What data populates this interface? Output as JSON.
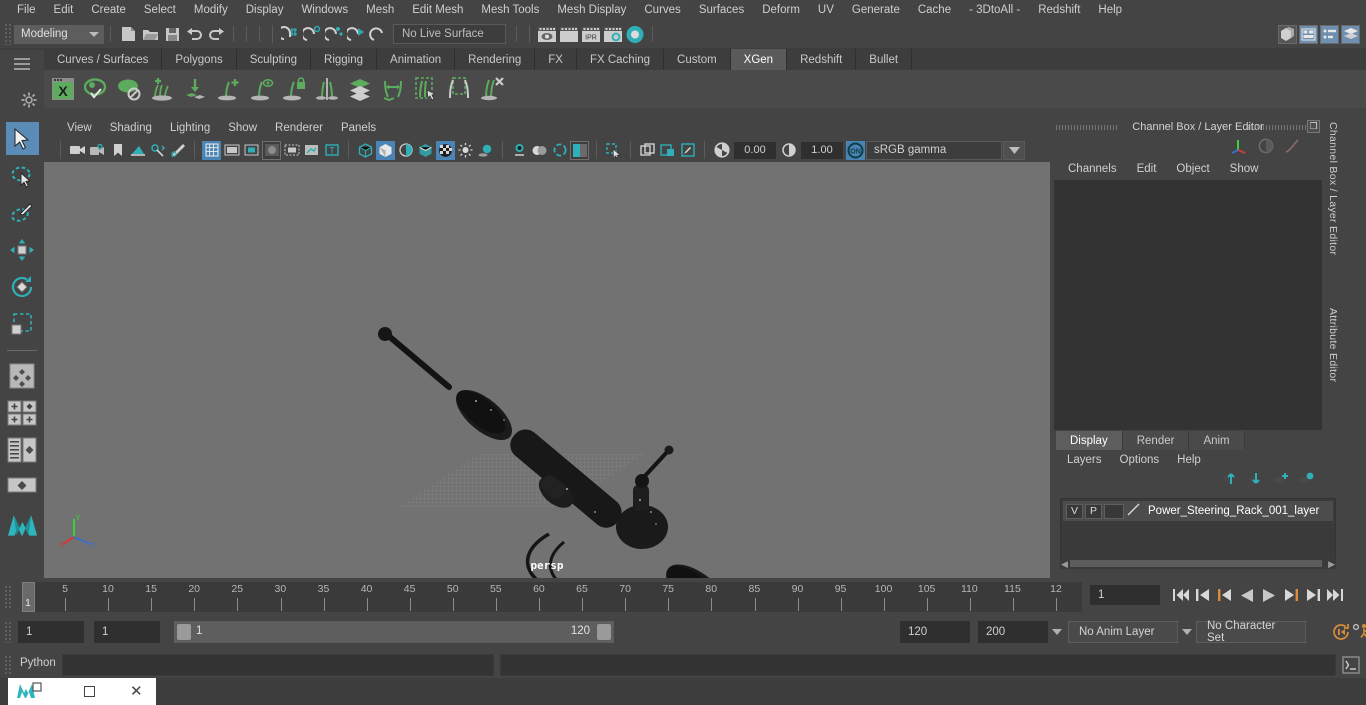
{
  "menubar": {
    "items": [
      "File",
      "Edit",
      "Create",
      "Select",
      "Modify",
      "Display",
      "Windows",
      "Mesh",
      "Edit Mesh",
      "Mesh Tools",
      "Mesh Display",
      "Curves",
      "Surfaces",
      "Deform",
      "UV",
      "Generate",
      "Cache",
      "- 3DtoAll -",
      "Redshift",
      "Help"
    ]
  },
  "statusbar": {
    "mode": "Modeling",
    "live_surface": "No Live Surface",
    "ipr_label": "IPR"
  },
  "shelf": {
    "tabs": [
      "Curves / Surfaces",
      "Polygons",
      "Sculpting",
      "Rigging",
      "Animation",
      "Rendering",
      "FX",
      "FX Caching",
      "Custom",
      "XGen",
      "Redshift",
      "Bullet"
    ],
    "active_tab": "XGen",
    "icons": [
      "xgen-editor-icon",
      "xgen-preview-icon",
      "xgen-hide-icon",
      "xgen-add-density-icon",
      "xgen-mask-icon",
      "xgen-add-guide-icon",
      "xgen-guide-preview-icon",
      "xgen-lock-guide-icon",
      "xgen-mirror-guide-icon",
      "xgen-layers-icon",
      "xgen-move-guide-icon",
      "xgen-select-region-icon",
      "xgen-clear-region-icon",
      "xgen-delete-guide-icon"
    ]
  },
  "toolbox": {
    "items": [
      "select-tool",
      "lasso-select-tool",
      "paint-select-tool",
      "move-tool",
      "rotate-tool",
      "scale-tool",
      "last-tool-used",
      "snap-grid-group",
      "outliner-persp-layout",
      "persp-layout",
      "maya-logo"
    ]
  },
  "viewport": {
    "menu": [
      "View",
      "Shading",
      "Lighting",
      "Show",
      "Renderer",
      "Panels"
    ],
    "exposure_value": "0.00",
    "gamma_value": "1.00",
    "color_management": "sRGB gamma",
    "camera_label": "persp",
    "axis_labels": [
      "y",
      "z",
      "x"
    ]
  },
  "channel_box": {
    "title": "Channel Box / Layer Editor",
    "menu": [
      "Channels",
      "Edit",
      "Object",
      "Show"
    ],
    "side_tabs": [
      "Channel Box / Layer Editor",
      "Attribute Editor"
    ]
  },
  "layer_editor": {
    "tabs": [
      "Display",
      "Render",
      "Anim"
    ],
    "active_tab": "Display",
    "menu": [
      "Layers",
      "Options",
      "Help"
    ],
    "layers": [
      {
        "visible": "V",
        "playback": "P",
        "color": "",
        "name": "Power_Steering_Rack_001_layer"
      }
    ]
  },
  "time_slider": {
    "tick_labels": [
      "5",
      "10",
      "15",
      "20",
      "25",
      "30",
      "35",
      "40",
      "45",
      "50",
      "55",
      "60",
      "65",
      "70",
      "75",
      "80",
      "85",
      "90",
      "95",
      "100",
      "105",
      "110",
      "115",
      "12"
    ],
    "current_frame": "1",
    "current_frame_field": "1",
    "playback_buttons": [
      "go-to-start",
      "step-back-key",
      "step-back-frame",
      "play-backwards",
      "play-forwards",
      "step-forward-frame",
      "step-forward-key",
      "go-to-end"
    ]
  },
  "range_slider": {
    "anim_start": "1",
    "range_start": "1",
    "range_bar_start": "1",
    "range_bar_end": "120",
    "range_end": "120",
    "anim_end": "200",
    "anim_layer": "No Anim Layer",
    "character_set": "No Character Set"
  },
  "command_line": {
    "language": "Python",
    "input_value": "",
    "output_value": ""
  },
  "taskbar": {
    "window_title": "",
    "minimize": "",
    "maximize": "",
    "close": "✕"
  },
  "colors": {
    "accent_blue": "#4a84b4",
    "accent_teal": "#2fb0b8",
    "xgen_green": "#5dab5d",
    "panel_bg": "#444444",
    "viewport_bg": "#727272",
    "orange": "#d98d3a"
  }
}
